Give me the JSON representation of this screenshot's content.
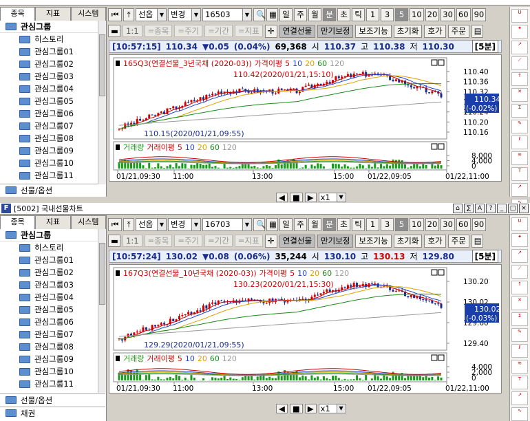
{
  "app": {
    "window_title": "[5002] 국내선물차트"
  },
  "sidebar": {
    "tabs": [
      "종목",
      "지표",
      "시스템"
    ],
    "root": "관심그룹",
    "items": [
      "히스토리",
      "관심그룹01",
      "관심그룹02",
      "관심그룹03",
      "관심그룹04",
      "관심그룹05",
      "관심그룹06",
      "관심그룹07",
      "관심그룹08",
      "관심그룹09",
      "관심그룹10",
      "관심그룹11"
    ],
    "footer": "선물/옵션",
    "footer2": "채권"
  },
  "toolbar": {
    "market": "선옵",
    "change": "변경",
    "periods": [
      "일",
      "주",
      "월",
      "분",
      "초",
      "틱"
    ],
    "active_period": "분",
    "intervals": [
      "1",
      "3",
      "5",
      "10",
      "20",
      "30",
      "60",
      "90"
    ],
    "active_interval": "5"
  },
  "toolbar2": {
    "disabled": [
      "=종목",
      "=주기",
      "=기간",
      "=지표"
    ],
    "buttons": [
      "연결선물",
      "만기보정",
      "보조기능",
      "초기화",
      "호가",
      "주문"
    ],
    "one_to_one": "1:1"
  },
  "panels": [
    {
      "code": "16503",
      "time": "[10:57:15]",
      "price": "110.34",
      "change": "▼0.05",
      "change_pct": "(0.04%)",
      "volume": "69,368",
      "open_label": "시",
      "open": "110.37",
      "high_label": "고",
      "high": "110.38",
      "low_label": "저",
      "low": "110.30",
      "period": "[5분]",
      "legend": "165Q3(연결선물_3년국채 (2020-03))",
      "ma_title": "가격이평",
      "ma_list": [
        "5",
        "10",
        "20",
        "60",
        "120"
      ],
      "max_label": "110.42(2020/01/21,15:10)",
      "min_label": "110.15(2020/01/21,09:55)",
      "price_axis": [
        "110.40",
        "110.36",
        "110.32",
        "110.28",
        "110.24",
        "110.20",
        "110.16"
      ],
      "last_box": "110.34",
      "last_pct": "(-0.02%)",
      "vol_legend": "거래량",
      "vol_ma_title": "거래이평",
      "vol_ma_list": [
        "5",
        "10",
        "20",
        "60",
        "120"
      ],
      "vol_axis": [
        "8,000",
        "4,000",
        "0"
      ],
      "time_axis": [
        "01/21,09:30",
        "11:00",
        "13:00",
        "15:00",
        "01/22,09:05",
        "01/22,11:00"
      ]
    },
    {
      "code": "16703",
      "time": "[10:57:24]",
      "price": "130.02",
      "change": "▼0.08",
      "change_pct": "(0.06%)",
      "volume": "35,244",
      "open_label": "시",
      "open": "130.10",
      "high_label": "고",
      "high": "130.13",
      "low_label": "저",
      "low": "129.80",
      "period": "[5분]",
      "legend": "167Q3(연결선물_10년국채 (2020-03))",
      "ma_title": "가격이평",
      "ma_list": [
        "5",
        "10",
        "20",
        "60",
        "120"
      ],
      "max_label": "130.23(2020/01/21,15:30)",
      "min_label": "129.29(2020/01/21,09:55)",
      "price_axis": [
        "130.20",
        "130.02",
        "129.60",
        "129.40"
      ],
      "last_box": "130.02",
      "last_pct": "(-0.03%)",
      "vol_legend": "거래량",
      "vol_ma_title": "거래이평",
      "vol_ma_list": [
        "5",
        "10",
        "20",
        "60",
        "120"
      ],
      "vol_axis": [
        "4,000",
        "2,000",
        "0"
      ],
      "time_axis": [
        "01/21,09:30",
        "11:00",
        "13:00",
        "15:00",
        "01/22,09:05",
        "01/22,11:00"
      ]
    }
  ],
  "bottom": {
    "zoom": "x1"
  },
  "colors": {
    "up": "#d00000",
    "down": "#1a2c8c",
    "ma5": "#cc0000",
    "ma10": "#2244cc",
    "ma20": "#e0a000",
    "ma60": "#1a8a1a",
    "ma120": "#999999",
    "vol": "#1a9a1a"
  }
}
